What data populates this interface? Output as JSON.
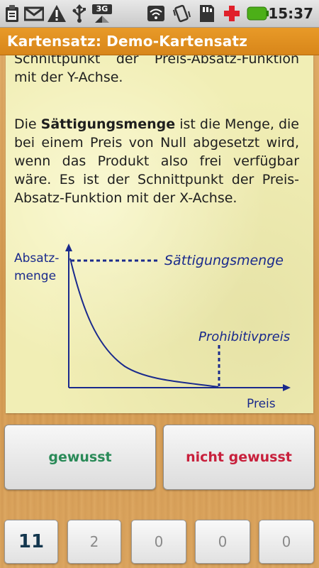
{
  "status_bar": {
    "time": "15:37",
    "network_label": "3G",
    "icons": [
      "clipboard-icon",
      "mail-icon",
      "warning-icon",
      "usb-icon",
      "3g-icon",
      "wifi-icon",
      "vibrate-icon",
      "sd-card-icon",
      "plus-icon",
      "battery-icon"
    ],
    "colors": {
      "plus": "#e0202a",
      "battery": "#4caf18"
    }
  },
  "title_bar": {
    "title": "Kartensatz: Demo-Kartensatz",
    "color": "#e0922a"
  },
  "card": {
    "intro_text": "Schnittpunkt der Preis-Absatz-Funktion mit der Y-Achse.",
    "para_prefix": "Die ",
    "para_term": "Sättigungsmenge",
    "para_suffix": " ist die Menge, die bei einem Preis von Null abgesetzt wird, wenn das Produkt also frei verfügbar wäre. Es ist der Schnittpunkt der Preis-Absatz-Funktion mit der X-Achse.",
    "graph": {
      "y_label_line1": "Absatz-",
      "y_label_line2": "menge",
      "x_label": "Preis",
      "saturation_label": "Sättigungsmenge",
      "prohibitive_label": "Prohibitivpreis",
      "line_color": "#1a2a8c"
    }
  },
  "buttons": {
    "known": "gewusst",
    "unknown": "nicht gewusst",
    "known_color": "#2a8a58",
    "unknown_color": "#c8203c"
  },
  "boxes": [
    "11",
    "2",
    "0",
    "0",
    "0"
  ]
}
